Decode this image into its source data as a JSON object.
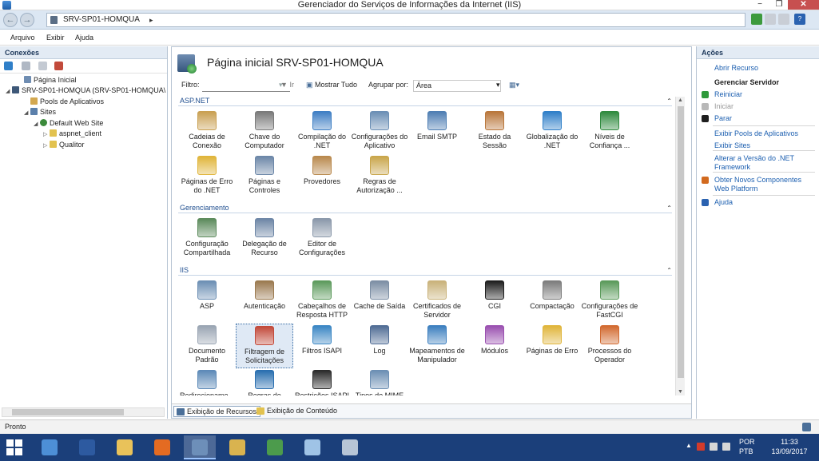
{
  "window": {
    "title": "Gerenciador do Serviços de Informações da Internet (IIS)",
    "min_glyph": "−",
    "max_glyph": "❐",
    "close_glyph": "✕"
  },
  "address": {
    "path": "SRV-SP01-HOMQUA",
    "separator": "▸",
    "back_glyph": "←",
    "forward_glyph": "→",
    "help_glyph": "?"
  },
  "menu": {
    "items": [
      "Arquivo",
      "Exibir",
      "Ajuda"
    ]
  },
  "connections": {
    "title": "Conexões",
    "tree": [
      {
        "label": "Página Inicial",
        "icon": "home-icon",
        "color": "#6f8db2",
        "expander": ""
      },
      {
        "label": "SRV-SP01-HOMQUA (SRV-SP01-HOMQUA\\",
        "icon": "server-icon",
        "color": "#3e5878",
        "expander": "◢"
      },
      {
        "label": "Pools de Aplicativos",
        "icon": "app-pool-icon",
        "color": "#d3a850",
        "expander": ""
      },
      {
        "label": "Sites",
        "icon": "sites-icon",
        "color": "#5b80ab",
        "expander": "◢"
      },
      {
        "label": "Default Web Site",
        "icon": "globe-icon",
        "color": "#3b8a3b",
        "expander": "◢"
      },
      {
        "label": "aspnet_client",
        "icon": "folder-icon",
        "color": "#e2c24f",
        "expander": "▷"
      },
      {
        "label": "Qualitor",
        "icon": "folder-icon",
        "color": "#e2c24f",
        "expander": "▷"
      }
    ]
  },
  "center": {
    "title": "Página inicial SRV-SP01-HOMQUA",
    "filter_label": "Filtro:",
    "ir_label": "Ir",
    "show_all_label": "Mostrar Tudo",
    "group_by_label": "Agrupar por:",
    "group_by_value": "Área",
    "collapse_glyph": "⌃",
    "scroll_up_glyph": "▲",
    "scroll_down_glyph": "▼",
    "groups": [
      {
        "name": "ASP.NET",
        "features": [
          {
            "label": "Cadeias de Conexão",
            "icon": "connection-strings-icon",
            "color": "#c9a052"
          },
          {
            "label": "Chave do Computador",
            "icon": "machine-key-icon",
            "color": "#7a7a7a"
          },
          {
            "label": "Compilação do .NET",
            "icon": "net-compilation-icon",
            "color": "#3f7fc4"
          },
          {
            "label": "Configurações do Aplicativo",
            "icon": "app-settings-icon",
            "color": "#6b8fb5"
          },
          {
            "label": "Email SMTP",
            "icon": "smtp-email-icon",
            "color": "#4e7eb3"
          },
          {
            "label": "Estado da Sessão",
            "icon": "session-state-icon",
            "color": "#b9773b"
          },
          {
            "label": "Globalização do .NET",
            "icon": "net-globalization-icon",
            "color": "#2f7fc8"
          },
          {
            "label": "Níveis de Confiança ...",
            "icon": "trust-levels-icon",
            "color": "#2f8a3e"
          },
          {
            "label": "Páginas de Erro do .NET",
            "icon": "net-error-pages-icon",
            "color": "#e0b53a"
          },
          {
            "label": "Páginas e Controles",
            "icon": "pages-controls-icon",
            "color": "#6c87a8"
          },
          {
            "label": "Provedores",
            "icon": "providers-icon",
            "color": "#b9894d"
          },
          {
            "label": "Regras de Autorização ...",
            "icon": "authorization-rules-icon",
            "color": "#c9a64b"
          }
        ]
      },
      {
        "name": "Gerenciamento",
        "features": [
          {
            "label": "Configuração Compartilhada",
            "icon": "shared-config-icon",
            "color": "#5b8a5b"
          },
          {
            "label": "Delegação de Recurso",
            "icon": "feature-delegation-icon",
            "color": "#6d86a6"
          },
          {
            "label": "Editor de Configurações",
            "icon": "config-editor-icon",
            "color": "#8a98aa"
          }
        ]
      },
      {
        "name": "IIS",
        "features": [
          {
            "label": "ASP",
            "icon": "asp-icon",
            "color": "#6c8fb4"
          },
          {
            "label": "Autenticação",
            "icon": "authentication-icon",
            "color": "#9b7a4f"
          },
          {
            "label": "Cabeçalhos de Resposta HTTP",
            "icon": "http-headers-icon",
            "color": "#5c9a5c"
          },
          {
            "label": "Cache de Saída",
            "icon": "output-cache-icon",
            "color": "#7c8ea4"
          },
          {
            "label": "Certificados de Servidor",
            "icon": "server-certificates-icon",
            "color": "#c9b27a"
          },
          {
            "label": "CGI",
            "icon": "cgi-icon",
            "color": "#1e1e1e"
          },
          {
            "label": "Compactação",
            "icon": "compression-icon",
            "color": "#7c7c7c"
          },
          {
            "label": "Configurações de FastCGI",
            "icon": "fastcgi-icon",
            "color": "#5a9a5a"
          },
          {
            "label": "Documento Padrão",
            "icon": "default-document-icon",
            "color": "#9aa5b3"
          },
          {
            "label": "Filtragem de Solicitações",
            "icon": "request-filtering-icon",
            "color": "#c24a3b"
          },
          {
            "label": "Filtros ISAPI",
            "icon": "isapi-filters-icon",
            "color": "#3a86c4"
          },
          {
            "label": "Log",
            "icon": "log-icon",
            "color": "#4f6c95"
          },
          {
            "label": "Mapeamentos de Manipulador",
            "icon": "handler-mappings-icon",
            "color": "#3c7fbf"
          },
          {
            "label": "Módulos",
            "icon": "modules-icon",
            "color": "#9a4fb0"
          },
          {
            "label": "Páginas de Erro",
            "icon": "error-pages-icon",
            "color": "#e0b53a"
          },
          {
            "label": "Processos do Operador",
            "icon": "worker-processes-icon",
            "color": "#d2692f"
          },
          {
            "label": "Redirecioname... HTTP",
            "icon": "http-redirect-icon",
            "color": "#5d8ab8"
          },
          {
            "label": "Regras de Solicitação ...",
            "icon": "request-rules-icon",
            "color": "#2a6fb0"
          },
          {
            "label": "Restrições ISAPI e CGI",
            "icon": "isapi-cgi-restrictions-icon",
            "color": "#2b2b2b"
          },
          {
            "label": "Tipos de MIME",
            "icon": "mime-types-icon",
            "color": "#6c8fb4"
          }
        ]
      }
    ],
    "selected_feature": "Filtragem de Solicitações",
    "tabs": [
      "Exibição de Recursos",
      "Exibição de Conteúdo"
    ]
  },
  "actions": {
    "title": "Ações",
    "items": [
      {
        "label": "Abrir Recurso",
        "kind": "link",
        "icon": ""
      },
      {
        "label": "Gerenciar Servidor",
        "kind": "header",
        "icon": ""
      },
      {
        "label": "Reiniciar",
        "kind": "link",
        "icon": "restart-icon",
        "color": "#2e9a3b"
      },
      {
        "label": "Iniciar",
        "kind": "disabled",
        "icon": "start-icon",
        "color": "#b8b8b8"
      },
      {
        "label": "Parar",
        "kind": "link",
        "icon": "stop-icon",
        "color": "#1e1e1e"
      },
      {
        "label": "Exibir Pools de Aplicativos",
        "kind": "link",
        "icon": ""
      },
      {
        "label": "Exibir Sites",
        "kind": "link",
        "icon": ""
      },
      {
        "label": "Alterar a Versão do .NET Framework",
        "kind": "link",
        "icon": ""
      },
      {
        "label": "Obter Novos Componentes Web Platform",
        "kind": "link",
        "icon": "web-platform-icon",
        "color": "#d26a1f"
      },
      {
        "label": "Ajuda",
        "kind": "link",
        "icon": "help-icon",
        "color": "#2a62b0"
      }
    ]
  },
  "status": {
    "text": "Pronto"
  },
  "taskbar": {
    "apps": [
      {
        "name": "server-manager-icon",
        "color": "#4d8fd6"
      },
      {
        "name": "powershell-icon",
        "color": "#2d5aa0"
      },
      {
        "name": "file-explorer-icon",
        "color": "#e9c25a"
      },
      {
        "name": "firefox-icon",
        "color": "#e46b22"
      },
      {
        "name": "iis-manager-icon",
        "color": "#6d8fb9"
      },
      {
        "name": "tools-icon",
        "color": "#d9b34f"
      },
      {
        "name": "chrome-icon",
        "color": "#4c9b4c"
      },
      {
        "name": "notepad-icon",
        "color": "#9fc3e6"
      },
      {
        "name": "performance-monitor-icon",
        "color": "#b7c5d6"
      }
    ],
    "active_app": 4,
    "language": "POR",
    "layout": "PTB",
    "time": "11:33",
    "date": "13/09/2017",
    "tray_arrow": "▲"
  }
}
